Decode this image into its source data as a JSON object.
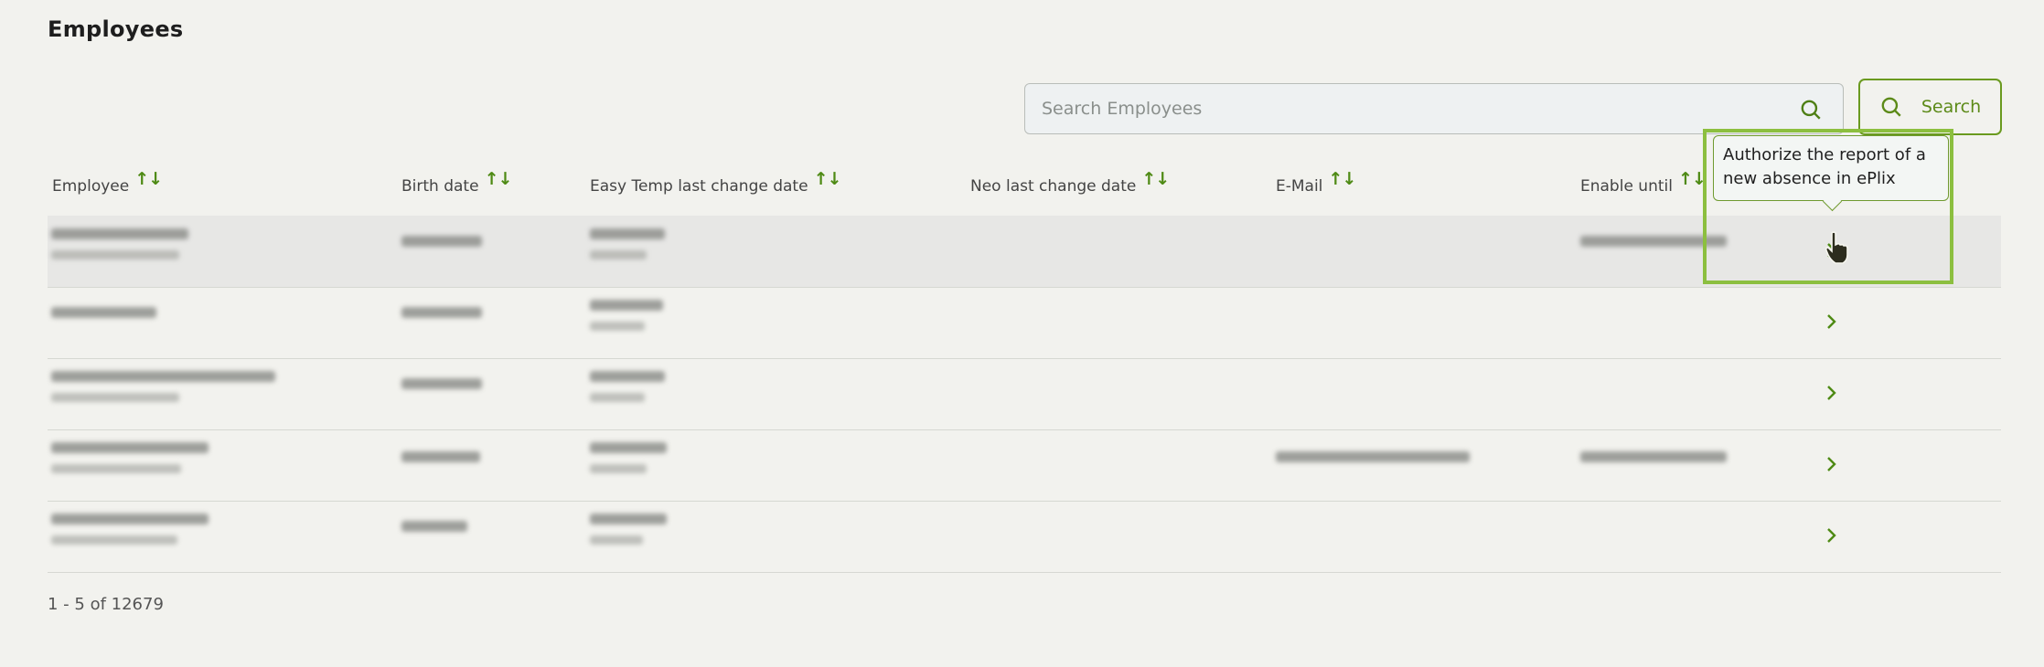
{
  "page": {
    "title": "Employees"
  },
  "search": {
    "placeholder": "Search Employees",
    "button_label": "Search"
  },
  "table": {
    "columns": [
      {
        "label": "Employee"
      },
      {
        "label": "Birth date"
      },
      {
        "label": "Easy Temp last change date"
      },
      {
        "label": "Neo last change date"
      },
      {
        "label": "E-Mail"
      },
      {
        "label": "Enable until"
      }
    ],
    "rows": [
      {
        "name": "[redacted]",
        "employee_number": "[redacted]",
        "birth_date": "[redacted]",
        "easytemp_date": "[redacted]",
        "easytemp_user": "[redacted]",
        "neo_date": "",
        "email": "",
        "enable_until": "[redacted]"
      },
      {
        "name": "[redacted]",
        "employee_number": "",
        "birth_date": "[redacted]",
        "easytemp_date": "[redacted]",
        "easytemp_user": "[redacted]",
        "neo_date": "",
        "email": "",
        "enable_until": ""
      },
      {
        "name": "[redacted]",
        "employee_number": "[redacted]",
        "birth_date": "[redacted]",
        "easytemp_date": "[redacted]",
        "easytemp_user": "[redacted]",
        "neo_date": "",
        "email": "",
        "enable_until": ""
      },
      {
        "name": "[redacted]",
        "employee_number": "[redacted]",
        "birth_date": "[redacted]",
        "easytemp_date": "[redacted]",
        "easytemp_user": "[redacted]",
        "neo_date": "",
        "email": "[redacted]",
        "enable_until": "[redacted]"
      },
      {
        "name": "[redacted]",
        "employee_number": "[redacted]",
        "birth_date": "[redacted]",
        "easytemp_date": "[redacted]",
        "easytemp_user": "[redacted]",
        "neo_date": "",
        "email": "",
        "enable_until": ""
      }
    ]
  },
  "pagination": {
    "summary": "1 - 5 of 12679"
  },
  "tooltip": {
    "text": "Authorize the report of a new absence in ePlix"
  },
  "icons": {
    "search": "search-icon",
    "sort": "sort-arrows-icon",
    "row_action": "chevron-right-icon",
    "cursor": "hand-pointer-cursor"
  },
  "colors": {
    "accent": "#5c8a18",
    "highlight": "#8cbf3f",
    "background": "#f2f2ee"
  }
}
